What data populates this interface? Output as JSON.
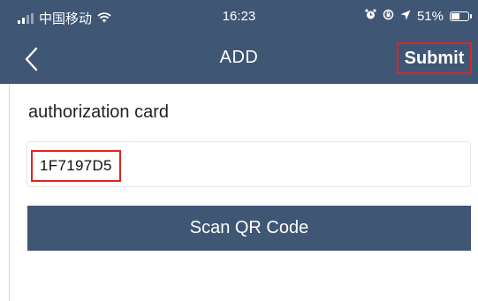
{
  "status_bar": {
    "carrier": "中国移动",
    "time": "16:23",
    "battery_percent": "51%",
    "battery_level": 0.51,
    "icons": [
      "signal-icon",
      "wifi-icon",
      "alarm-icon",
      "orientation-lock-icon",
      "location-icon",
      "battery-icon"
    ]
  },
  "nav": {
    "title": "ADD",
    "back_icon": "chevron-left-icon",
    "submit_label": "Submit"
  },
  "form": {
    "label": "authorization card",
    "card_value": "1F7197D5",
    "scan_label": "Scan QR Code"
  },
  "colors": {
    "header_bg": "#3f5675",
    "highlight": "#e0251f",
    "button_bg": "#3f5675"
  }
}
